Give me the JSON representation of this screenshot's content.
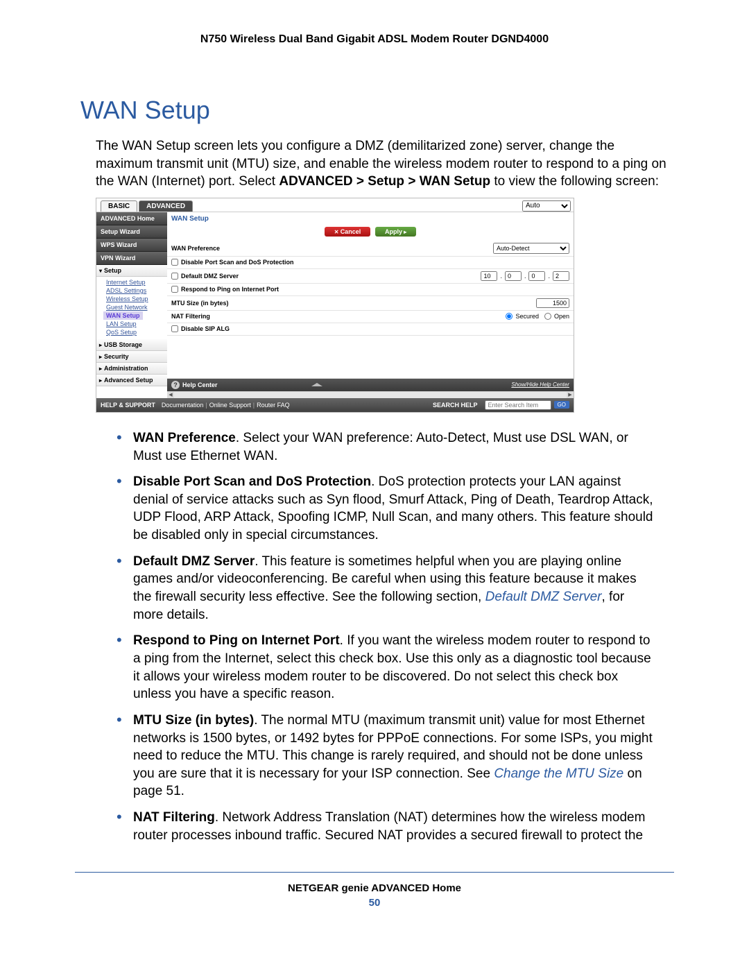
{
  "header": "N750 Wireless Dual Band Gigabit ADSL Modem Router DGND4000",
  "section_title": "WAN Setup",
  "intro_pre": "The WAN Setup screen lets you configure a DMZ (demilitarized zone) server, change the maximum transmit unit (MTU) size, and enable the wireless modem router to respond to a ping on the WAN (Internet) port. Select ",
  "intro_bold": "ADVANCED > Setup > WAN Setup",
  "intro_post": " to view the following screen:",
  "router": {
    "tab_basic": "BASIC",
    "tab_advanced": "ADVANCED",
    "top_select": "Auto",
    "nav_dark": [
      "ADVANCED Home",
      "Setup Wizard",
      "WPS Wizard",
      "VPN Wizard"
    ],
    "setup_label": "Setup",
    "setup_items": [
      "Internet Setup",
      "ADSL Settings",
      "Wireless Setup",
      "Guest Network",
      "WAN Setup",
      "LAN Setup",
      "QoS Setup"
    ],
    "setup_active_index": 4,
    "other_sections": [
      "USB Storage",
      "Security",
      "Administration",
      "Advanced Setup"
    ],
    "pane_title": "WAN Setup",
    "btn_cancel": "Cancel",
    "btn_apply": "Apply",
    "row_wan_pref": "WAN Preference",
    "wan_pref_value": "Auto-Detect",
    "row_dos": "Disable Port Scan and DoS Protection",
    "row_dmz": "Default DMZ Server",
    "dmz_ip": [
      "10",
      "0",
      "0",
      "2"
    ],
    "row_ping": "Respond to Ping on Internet Port",
    "row_mtu": "MTU Size (in bytes)",
    "mtu_value": "1500",
    "row_nat": "NAT Filtering",
    "nat_secured": "Secured",
    "nat_open": "Open",
    "row_sip": "Disable SIP ALG",
    "help_center": "Help Center",
    "showhide": "Show/Hide Help Center",
    "support_label": "HELP & SUPPORT",
    "support_links": [
      "Documentation",
      "Online Support",
      "Router FAQ"
    ],
    "search_label": "SEARCH HELP",
    "search_placeholder": "Enter Search Item",
    "go": "GO"
  },
  "bullets": [
    {
      "bold": "WAN Preference",
      "rest": ". Select your WAN preference: Auto-Detect, Must use DSL WAN, or Must use Ethernet WAN."
    },
    {
      "bold": "Disable Port Scan and DoS Protection",
      "rest": ". DoS protection protects your LAN against denial of service attacks such as Syn flood, Smurf Attack, Ping of Death, Teardrop Attack, UDP Flood, ARP Attack, Spoofing ICMP, Null Scan, and many others. This feature should be disabled only in special circumstances."
    },
    {
      "bold": "Default DMZ Server",
      "rest_pre": ". This feature is sometimes helpful when you are playing online games and/or videoconferencing. Be careful when using this feature because it makes the firewall security less effective. See the following section, ",
      "link": "Default DMZ Server",
      "rest_post": ", for more details."
    },
    {
      "bold": "Respond to Ping on Internet Port",
      "rest": ". If you want the wireless modem router to respond to a ping from the Internet, select this check box. Use this only as a diagnostic tool because it allows your wireless modem router to be discovered. Do not select this check box unless you have a specific reason."
    },
    {
      "bold": "MTU Size (in bytes)",
      "rest_pre": ". The normal MTU (maximum transmit unit) value for most Ethernet networks is 1500 bytes, or 1492 bytes for PPPoE connections. For some ISPs, you might need to reduce the MTU. This change is rarely required, and should not be done unless you are sure that it is necessary for your ISP connection. See ",
      "link": "Change the MTU Size",
      "rest_post": " on page 51."
    },
    {
      "bold": "NAT Filtering",
      "rest": ". Network Address Translation (NAT) determines how the wireless modem router processes inbound traffic. Secured NAT provides a secured firewall to protect the"
    }
  ],
  "footer_title": "NETGEAR genie ADVANCED Home",
  "page_num": "50"
}
